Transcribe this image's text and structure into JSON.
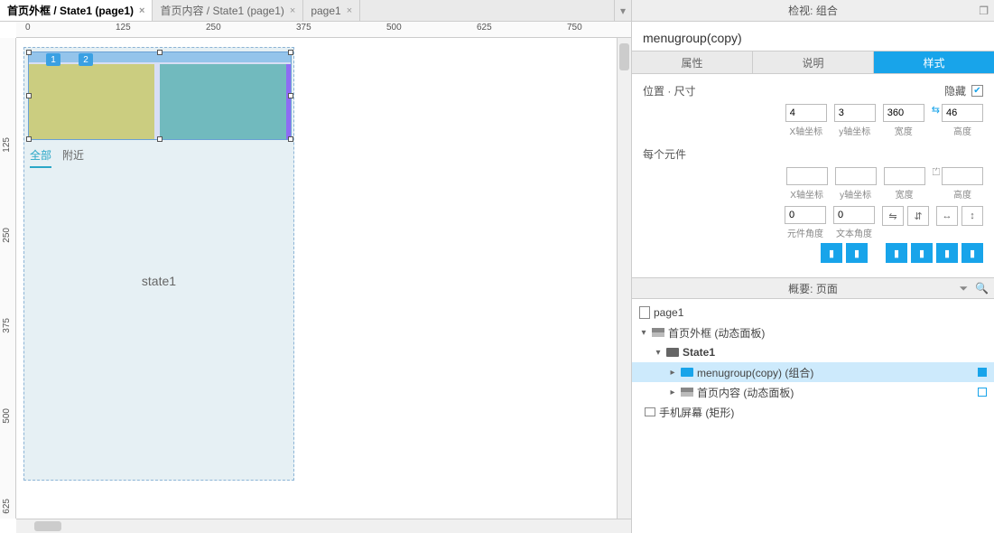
{
  "tabs": [
    {
      "label": "首页外框 / State1 (page1)"
    },
    {
      "label": "首页内容 / State1 (page1)"
    },
    {
      "label": "page1"
    }
  ],
  "ruler_h": [
    "0",
    "125",
    "250",
    "375",
    "500",
    "625",
    "750"
  ],
  "ruler_v": [
    "125",
    "250",
    "375",
    "500",
    "625"
  ],
  "badges": {
    "b1": "1",
    "b2": "2"
  },
  "mini_tabs": {
    "all": "全部",
    "near": "附近"
  },
  "state_label": "state1",
  "inspector": {
    "title": "检视: 组合",
    "selection_name": "menugroup(copy)",
    "tabs": {
      "properties": "属性",
      "notes": "说明",
      "style": "样式"
    },
    "sections": {
      "pos_size": "位置 · 尺寸",
      "hide": "隐藏",
      "per_element": "每个元件"
    },
    "fields": {
      "x": {
        "value": "4",
        "label": "X轴坐标"
      },
      "y": {
        "value": "3",
        "label": "y轴坐标"
      },
      "w": {
        "value": "360",
        "label": "宽度"
      },
      "h": {
        "value": "46",
        "label": "高度"
      },
      "x2_label": "X轴坐标",
      "y2_label": "y轴坐标",
      "w2_label": "宽度",
      "h2_label": "高度",
      "rot": {
        "value": "0",
        "label": "元件角度"
      },
      "trot": {
        "value": "0",
        "label": "文本角度"
      }
    }
  },
  "outline": {
    "title": "概要: 页面",
    "items": {
      "page": "page1",
      "outer": "首页外框 (动态面板)",
      "state": "State1",
      "group": "menugroup(copy) (组合)",
      "content": "首页内容 (动态面板)",
      "phone": "手机屏幕 (矩形)"
    }
  }
}
